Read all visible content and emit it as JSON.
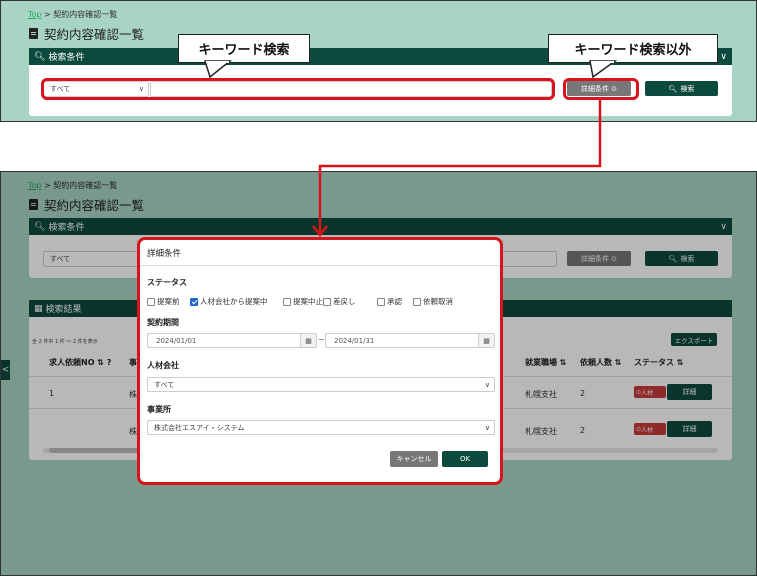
{
  "breadcrumb": {
    "top": "Top",
    "sep": ">",
    "current": "契約内容確認一覧"
  },
  "page_title": "契約内容確認一覧",
  "search_panel": {
    "header": "検索条件",
    "select_value": "すべて",
    "detail_button": "詳細条件 ⊙",
    "search_button": "検索"
  },
  "callouts": {
    "keyword": "キーワード検索",
    "other": "キーワード検索以外"
  },
  "results": {
    "header": "検索結果",
    "count_text": "全 2 件中 1 件 ～ 2 件を表示",
    "export_button": "エクスポート",
    "columns": {
      "req_no": "求人依頼NO",
      "col2": "事",
      "workplace": "就業職場",
      "count": "依頼人数",
      "status": "ステータス"
    },
    "rows": [
      {
        "no": "1",
        "col2": "株",
        "workplace": "札幌支社",
        "count": "2",
        "status": "人材",
        "action": "詳細"
      },
      {
        "no": "",
        "col2": "株",
        "workplace": "札幌支社",
        "count": "2",
        "status": "人材",
        "action": "詳細"
      }
    ]
  },
  "modal": {
    "title": "詳細条件",
    "status_label": "ステータス",
    "status_options": [
      {
        "label": "提案前",
        "checked": false
      },
      {
        "label": "人材会社から提案中",
        "checked": true
      },
      {
        "label": "提案中止",
        "checked": false
      },
      {
        "label": "差戻し",
        "checked": false
      },
      {
        "label": "承認",
        "checked": false
      },
      {
        "label": "依頼取消",
        "checked": false
      }
    ],
    "period_label": "契約期間",
    "date_from": "2024/01/01",
    "date_to": "2024/01/31",
    "tilde": "~",
    "company_label": "人材会社",
    "company_value": "すべて",
    "office_label": "事業所",
    "office_value": "株式会社エスアイ・システム",
    "cancel_button": "キャンセル",
    "ok_button": "OK"
  },
  "colors": {
    "brand": "#0d4a3e",
    "highlight": "#d7131b",
    "background": "#a8d4c4"
  }
}
